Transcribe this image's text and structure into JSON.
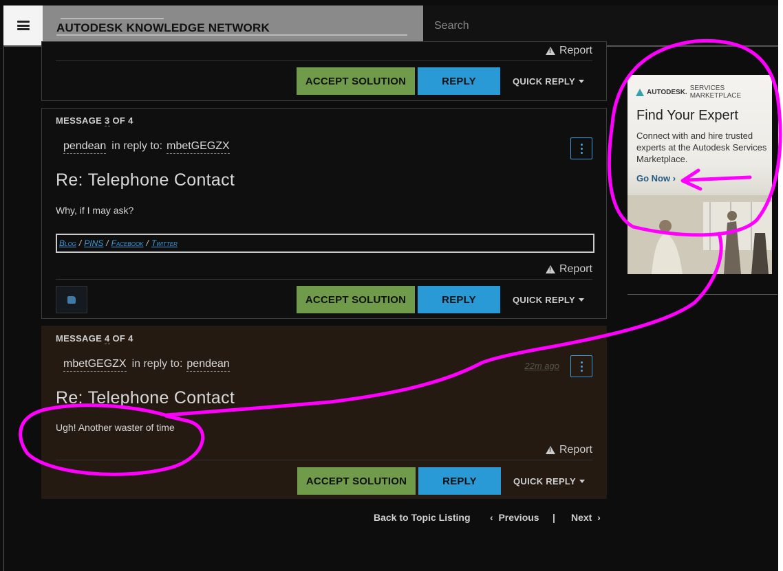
{
  "header": {
    "brand": "AUTODESK KNOWLEDGE NETWORK",
    "search_placeholder": "Search"
  },
  "top_card": {
    "report": "Report",
    "accept": "ACCEPT SOLUTION",
    "reply": "REPLY",
    "quick_reply": "QUICK REPLY"
  },
  "message3": {
    "label_prefix": "MESSAGE",
    "num": "3",
    "label_suffix": "OF 4",
    "author": "pendean",
    "in_reply_to": "in reply to:",
    "reply_to_user": "mbetGEGZX",
    "title": "Re: Telephone Contact",
    "body": "Why, if I may ask?",
    "signature": {
      "blog": "Blog",
      "pins": "PINS",
      "facebook": "Facebook",
      "twitter": "Twitter",
      "sep": "/"
    },
    "report": "Report",
    "accept": "ACCEPT SOLUTION",
    "reply": "REPLY",
    "quick_reply": "QUICK REPLY"
  },
  "message4": {
    "label_prefix": "MESSAGE",
    "num": "4",
    "label_suffix": "OF 4",
    "author": "mbetGEGZX",
    "in_reply_to": "in reply to:",
    "reply_to_user": "pendean",
    "time_ago": "22m ago",
    "title": "Re: Telephone Contact",
    "body": "Ugh! Another waster of time",
    "report": "Report",
    "accept": "ACCEPT SOLUTION",
    "reply": "REPLY",
    "quick_reply": "QUICK REPLY"
  },
  "bottom_nav": {
    "back": "Back to Topic Listing",
    "previous": "Previous",
    "divider": "|",
    "next": "Next"
  },
  "ad": {
    "brand": "AUTODESK.",
    "brand_sub": "SERVICES MARKETPLACE",
    "title": "Find Your Expert",
    "text": "Connect with and hire trusted experts at the Autodesk Services Marketplace.",
    "cta": "Go Now"
  },
  "colors": {
    "accept": "#6f9b4a",
    "reply": "#2a9ad6",
    "annotation": "#ff00ff",
    "highlight_bg": "#241a12"
  }
}
